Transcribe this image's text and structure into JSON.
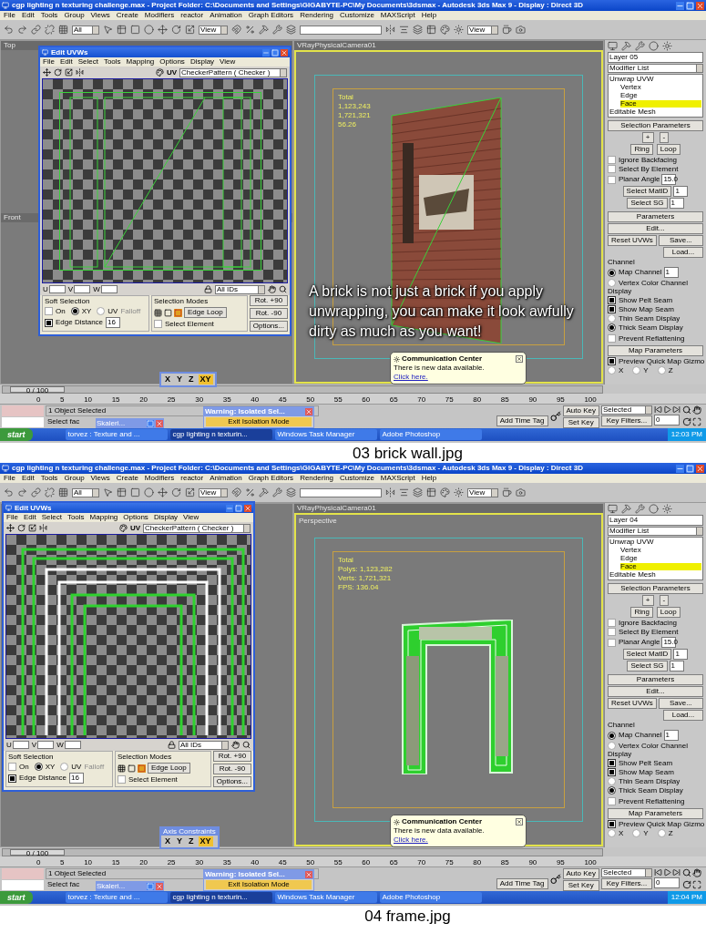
{
  "screens": [
    {
      "title_bar": {
        "title": "cgp lighting n texturing challenge.max   - Project Folder: C:\\Documents and Settings\\GIGABYTE-PC\\My Documents\\3dsmax   - Autodesk 3ds Max 9   - Display : Direct 3D"
      },
      "menu": [
        "File",
        "Edit",
        "Tools",
        "Group",
        "Views",
        "Create",
        "Modifiers",
        "reactor",
        "Animation",
        "Graph Editors",
        "Rendering",
        "Customize",
        "MAXScript",
        "Help"
      ],
      "toolbar": {
        "dropdowns": [
          "All",
          "View",
          "View"
        ]
      },
      "viewports": {
        "small": [
          "Top",
          "Front"
        ],
        "camera": {
          "label": "VRayPhysicalCamera01",
          "stats": [
            "Total",
            "1,123,243",
            "1,721,321",
            "56.26"
          ]
        }
      },
      "object": {
        "kind": "wall"
      },
      "overlay_text": "A brick is not just a brick if you apply unwrapping, you can make it look awfully dirty as much as you want!",
      "uvw_editor": {
        "title": "Edit UVWs",
        "menu": [
          "File",
          "Edit",
          "Select",
          "Tools",
          "Mapping",
          "Options",
          "Display",
          "View"
        ],
        "uv_label": "UV",
        "map": "CheckerPattern ( Checker )",
        "coords": [
          "U",
          "V",
          "W"
        ],
        "ids": "All IDs",
        "soft_selection": {
          "title": "Soft Selection",
          "on": {
            "label": "On",
            "checked": false
          },
          "spaces": [
            {
              "label": "XY",
              "selected": true
            },
            {
              "label": "UV",
              "selected": false
            }
          ],
          "falloff": "Falloff",
          "edge_distance": {
            "label": "Edge Distance",
            "checked": true,
            "value": "16"
          }
        },
        "selection_modes": {
          "title": "Selection Modes",
          "edge_loop": "Edge Loop",
          "select_element": {
            "label": "Select Element",
            "checked": false
          }
        },
        "buttons": [
          "Rot. +90",
          "Rot. -90",
          "Options..."
        ]
      },
      "axis_constraints": {
        "buttons": [
          {
            "label": "X",
            "selected": false
          },
          {
            "label": "Y",
            "selected": false
          },
          {
            "label": "Z",
            "selected": false
          },
          {
            "label": "XY",
            "selected": true
          }
        ]
      },
      "warning": {
        "title": "Warning: Isolated Sel...",
        "button": "Exit Isolation Mode"
      },
      "mini_window": {
        "title": "Skaleri..."
      },
      "communication": {
        "title": "Communication Center",
        "text": "There is new data available.",
        "link": "Click here."
      },
      "command_panel": {
        "layer": "Layer 05",
        "modifier_list": "Modifier List",
        "stack": [
          {
            "label": "Unwrap UVW",
            "selected": false,
            "children": [
              {
                "label": "Vertex",
                "selected": false
              },
              {
                "label": "Edge",
                "selected": false
              },
              {
                "label": "Face",
                "selected": true
              }
            ]
          },
          {
            "label": "Editable Mesh",
            "selected": false
          }
        ],
        "selection": {
          "title": "Selection Parameters",
          "grow": "+",
          "shrink": "-",
          "ring": "Ring",
          "loop": "Loop",
          "checks": [
            {
              "label": "Ignore Backfacing",
              "checked": false
            },
            {
              "label": "Select By Element",
              "checked": false
            },
            {
              "label": "Planar Angle",
              "checked": false
            }
          ],
          "angle": "15.0",
          "matid": "Select MatID",
          "matid_value": "1",
          "sg": "Select SG",
          "sg_value": "1"
        },
        "parameters": {
          "title": "Parameters",
          "edit": "Edit...",
          "reset": "Reset UVWs",
          "save": "Save...",
          "load": "Load...",
          "channel": "Channel",
          "channels": [
            {
              "label": "Map Channel",
              "selected": true
            },
            {
              "label": "Vertex Color Channel",
              "selected": false
            }
          ],
          "channel_value": "1",
          "display": "Display",
          "seams": [
            {
              "label": "Show Pelt Seam",
              "checked": true
            },
            {
              "label": "Show Map Seam",
              "checked": true
            }
          ],
          "seam_styles": [
            {
              "label": "Thin Seam Display",
              "selected": false
            },
            {
              "label": "Thick Seam Display",
              "selected": true
            }
          ],
          "prevent": {
            "label": "Prevent Reflattening",
            "checked": false
          }
        },
        "map_parameters": {
          "title": "Map Parameters",
          "preview": {
            "label": "Preview Quick Map Gizmo",
            "checked": true
          },
          "axes": [
            {
              "label": "X",
              "selected": false
            },
            {
              "label": "Y",
              "selected": false
            },
            {
              "label": "Z",
              "selected": false
            }
          ]
        }
      },
      "timeline": {
        "position": "0 / 100",
        "ticks": [
          "0",
          "5",
          "10",
          "15",
          "20",
          "25",
          "30",
          "35",
          "40",
          "45",
          "50",
          "55",
          "60",
          "65",
          "70",
          "75",
          "80",
          "85",
          "90",
          "95",
          "100"
        ]
      },
      "status": {
        "message": "1 Object Selected",
        "prompt": "Select fac"
      },
      "keys": {
        "add_time_tag": "Add Time Tag",
        "auto_key": "Auto Key",
        "selection": "Selected",
        "set_key": "Set Key",
        "key_filters": "Key Filters...",
        "frame": "0"
      },
      "taskbar": {
        "start": "start",
        "tasks": [
          {
            "label": "torvez : Texture and ...",
            "selected": false
          },
          {
            "label": "cgp lighting n texturin...",
            "selected": true
          },
          {
            "label": "Windows Task Manager",
            "selected": false
          },
          {
            "label": "Adobe Photoshop",
            "selected": false
          }
        ],
        "clock": "12:03 PM"
      },
      "caption": "03 brick wall.jpg"
    },
    {
      "title_bar": {
        "title": "cgp lighting n texturing challenge.max   - Project Folder: C:\\Documents and Settings\\GIGABYTE-PC\\My Documents\\3dsmax   - Autodesk 3ds Max 9   - Display : Direct 3D"
      },
      "menu": [
        "File",
        "Edit",
        "Tools",
        "Group",
        "Views",
        "Create",
        "Modifiers",
        "reactor",
        "Animation",
        "Graph Editors",
        "Rendering",
        "Customize",
        "MAXScript",
        "Help"
      ],
      "toolbar": {
        "dropdowns": [
          "All",
          "View",
          "View"
        ]
      },
      "viewports": {
        "camera": {
          "label": "VRayPhysicalCamera01",
          "view_label": "Perspective",
          "stats": [
            "Total",
            "Polys: 1,123,282",
            "Verts: 1,721,321",
            "FPS: 136.04"
          ]
        }
      },
      "object": {
        "kind": "frame"
      },
      "uvw_editor": {
        "title": "Edit UVWs",
        "menu": [
          "File",
          "Edit",
          "Select",
          "Tools",
          "Mapping",
          "Options",
          "Display",
          "View"
        ],
        "uv_label": "UV",
        "map": "CheckerPattern ( Checker )",
        "coords": [
          "U",
          "V",
          "W"
        ],
        "ids": "All IDs",
        "soft_selection": {
          "title": "Soft Selection",
          "on": {
            "label": "On",
            "checked": false
          },
          "spaces": [
            {
              "label": "XY",
              "selected": true
            },
            {
              "label": "UV",
              "selected": false
            }
          ],
          "falloff": "Falloff",
          "edge_distance": {
            "label": "Edge Distance",
            "checked": true,
            "value": "16"
          }
        },
        "selection_modes": {
          "title": "Selection Modes",
          "edge_loop": "Edge Loop",
          "select_element": {
            "label": "Select Element",
            "checked": false
          }
        },
        "buttons": [
          "Rot. +90",
          "Rot. -90",
          "Options..."
        ]
      },
      "axis_constraints": {
        "title": "Axis Constraints",
        "buttons": [
          {
            "label": "X",
            "selected": false
          },
          {
            "label": "Y",
            "selected": false
          },
          {
            "label": "Z",
            "selected": false
          },
          {
            "label": "XY",
            "selected": true
          }
        ]
      },
      "warning": {
        "title": "Warning: Isolated Sel...",
        "button": "Exit Isolation Mode"
      },
      "mini_window": {
        "title": "Skaleri..."
      },
      "communication": {
        "title": "Communication Center",
        "text": "There is new data available.",
        "link": "Click here."
      },
      "command_panel": {
        "layer": "Layer 04",
        "modifier_list": "Modifier List",
        "stack": [
          {
            "label": "Unwrap UVW",
            "selected": false,
            "children": [
              {
                "label": "Vertex",
                "selected": false
              },
              {
                "label": "Edge",
                "selected": false
              },
              {
                "label": "Face",
                "selected": true
              }
            ]
          },
          {
            "label": "Editable Mesh",
            "selected": false
          }
        ],
        "selection": {
          "title": "Selection Parameters",
          "grow": "+",
          "shrink": "-",
          "ring": "Ring",
          "loop": "Loop",
          "checks": [
            {
              "label": "Ignore Backfacing",
              "checked": false
            },
            {
              "label": "Select By Element",
              "checked": false
            },
            {
              "label": "Planar Angle",
              "checked": false
            }
          ],
          "angle": "15.0",
          "matid": "Select MatID",
          "matid_value": "1",
          "sg": "Select SG",
          "sg_value": "1"
        },
        "parameters": {
          "title": "Parameters",
          "edit": "Edit...",
          "reset": "Reset UVWs",
          "save": "Save...",
          "load": "Load...",
          "channel": "Channel",
          "channels": [
            {
              "label": "Map Channel",
              "selected": true
            },
            {
              "label": "Vertex Color Channel",
              "selected": false
            }
          ],
          "channel_value": "1",
          "display": "Display",
          "seams": [
            {
              "label": "Show Pelt Seam",
              "checked": true
            },
            {
              "label": "Show Map Seam",
              "checked": true
            }
          ],
          "seam_styles": [
            {
              "label": "Thin Seam Display",
              "selected": false
            },
            {
              "label": "Thick Seam Display",
              "selected": true
            }
          ],
          "prevent": {
            "label": "Prevent Reflattening",
            "checked": false
          }
        },
        "map_parameters": {
          "title": "Map Parameters",
          "preview": {
            "label": "Preview Quick Map Gizmo",
            "checked": true
          },
          "axes": [
            {
              "label": "X",
              "selected": false
            },
            {
              "label": "Y",
              "selected": false
            },
            {
              "label": "Z",
              "selected": false
            }
          ]
        }
      },
      "timeline": {
        "position": "0 / 100",
        "ticks": [
          "0",
          "5",
          "10",
          "15",
          "20",
          "25",
          "30",
          "35",
          "40",
          "45",
          "50",
          "55",
          "60",
          "65",
          "70",
          "75",
          "80",
          "85",
          "90",
          "95",
          "100"
        ]
      },
      "status": {
        "message": "1 Object Selected",
        "prompt": "Select fac"
      },
      "keys": {
        "add_time_tag": "Add Time Tag",
        "auto_key": "Auto Key",
        "selection": "Selected",
        "set_key": "Set Key",
        "key_filters": "Key Filters...",
        "frame": "0"
      },
      "taskbar": {
        "start": "start",
        "tasks": [
          {
            "label": "torvez : Texture and ...",
            "selected": false
          },
          {
            "label": "cgp lighting n texturin...",
            "selected": true
          },
          {
            "label": "Windows Task Manager",
            "selected": false
          },
          {
            "label": "Adobe Photoshop",
            "selected": false
          }
        ],
        "clock": "12:04 PM"
      },
      "caption": "04 frame.jpg"
    }
  ]
}
